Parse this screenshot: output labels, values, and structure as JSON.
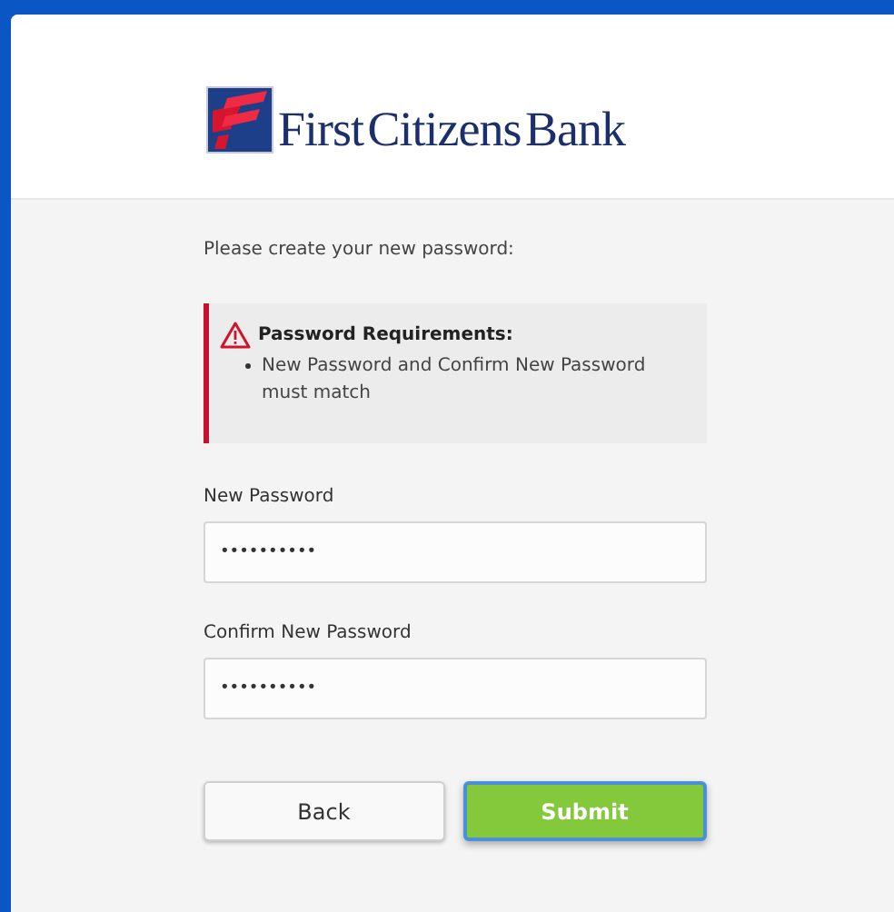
{
  "logo": {
    "text": "First Citizens Bank"
  },
  "intro": "Please create your new password:",
  "alert": {
    "title": "Password Requirements:",
    "items": [
      "New Password and Confirm New Password must match"
    ]
  },
  "fields": [
    {
      "label": "New Password",
      "value": "••••••••••"
    },
    {
      "label": "Confirm New Password",
      "value": "••••••••••"
    }
  ],
  "buttons": [
    {
      "label": "Back",
      "kind": "secondary",
      "focused": false
    },
    {
      "label": "Submit",
      "kind": "primary",
      "focused": true
    }
  ]
}
